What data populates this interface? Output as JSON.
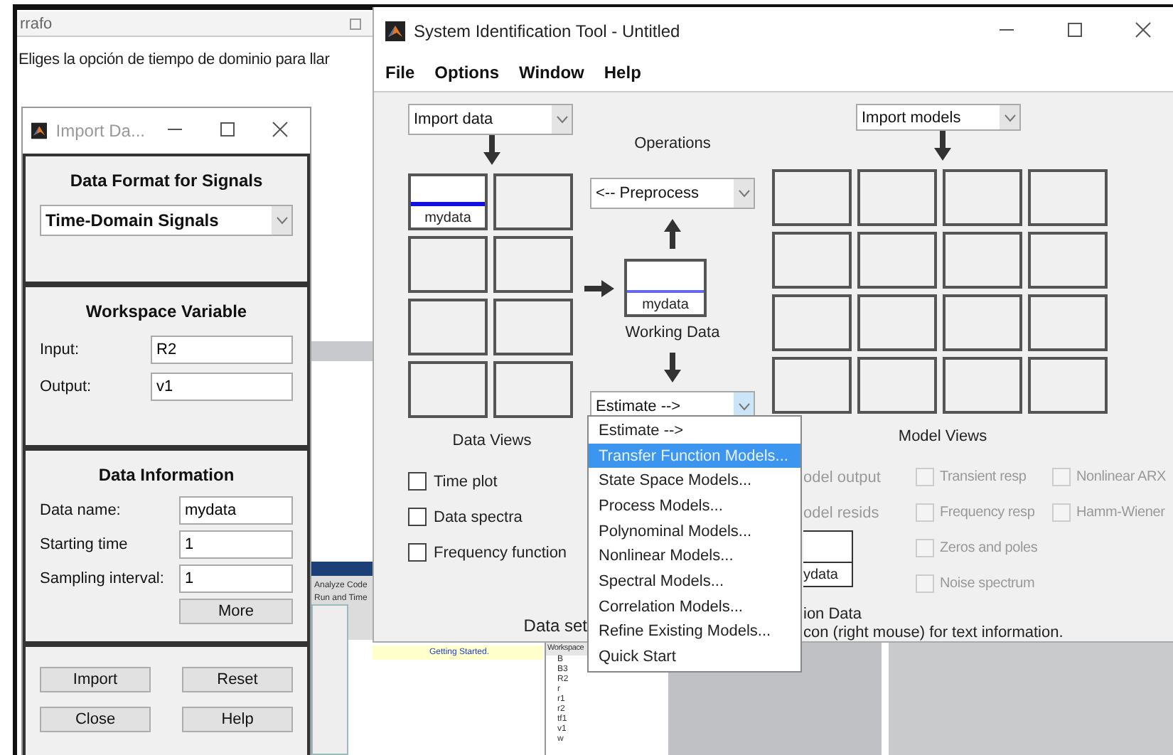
{
  "background_document": {
    "tab_label": "rrafo",
    "text": "Eliges la opción de tiempo de dominio para llar"
  },
  "background_matlab": {
    "toolbar": [
      "Analyze Code",
      "Run and Time"
    ],
    "link": "Getting Started.",
    "workspace_title": "Workspace",
    "variables": [
      "B",
      "B3",
      "R2",
      "r",
      "r1",
      "r2",
      "tf1",
      "v1",
      "w"
    ]
  },
  "import_dialog": {
    "title": "Import Da...",
    "format_title": "Data Format for Signals",
    "format": "Time-Domain Signals",
    "workspace_title": "Workspace Variable",
    "fields": [
      {
        "label": "Input:",
        "value": "R2"
      },
      {
        "label": "Output:",
        "value": "v1"
      }
    ],
    "info_title": "Data Information",
    "info_fields": [
      {
        "label": "Data name:",
        "value": "mydata"
      },
      {
        "label": "Starting time",
        "value": "1"
      },
      {
        "label": "Sampling interval:",
        "value": "1"
      }
    ],
    "more": "More",
    "buttons": [
      "Import",
      "Reset",
      "Close",
      "Help"
    ]
  },
  "main_window": {
    "title": "System Identification Tool - Untitled",
    "menu": [
      "File",
      "Options",
      "Window",
      "Help"
    ],
    "import_data": "Import data",
    "data_board": [
      {
        "label": "mydata"
      }
    ],
    "operations_title": "Operations",
    "preprocess": "<-- Preprocess",
    "working_data": {
      "label": "mydata",
      "title": "Working Data"
    },
    "estimate": "Estimate -->",
    "import_models": "Import models",
    "data_views": {
      "title": "Data Views",
      "options": [
        {
          "label": "Time plot",
          "checked": false,
          "disabled": false
        },
        {
          "label": "Data spectra",
          "checked": false,
          "disabled": false
        },
        {
          "label": "Frequency function",
          "checked": false,
          "disabled": false
        }
      ]
    },
    "data_set_label": "Data set",
    "model_views": {
      "title": "Model Views",
      "partial": [
        "odel output",
        "odel resids"
      ],
      "validation_label": "ydata",
      "validation_title": "ion Data",
      "hint": "con (right mouse) for text information.",
      "option_columns": [
        [
          {
            "label": "Transient resp",
            "checked": false,
            "disabled": true
          },
          {
            "label": "Frequency resp",
            "checked": false,
            "disabled": true
          },
          {
            "label": "Zeros and poles",
            "checked": false,
            "disabled": true
          },
          {
            "label": "Noise spectrum",
            "checked": false,
            "disabled": true
          }
        ],
        [
          {
            "label": "Nonlinear ARX",
            "checked": false,
            "disabled": true
          },
          {
            "label": "Hamm-Wiener",
            "checked": false,
            "disabled": true
          }
        ]
      ]
    }
  },
  "estimate_menu": [
    {
      "label": "Estimate -->",
      "selected": false
    },
    {
      "label": "Transfer Function Models...",
      "selected": true
    },
    {
      "label": "State Space Models...",
      "selected": false
    },
    {
      "label": "Process Models...",
      "selected": false
    },
    {
      "label": "Polynominal Models...",
      "selected": false
    },
    {
      "label": "Nonlinear Models...",
      "selected": false
    },
    {
      "label": "Spectral Models...",
      "selected": false
    },
    {
      "label": "Correlation Models...",
      "selected": false
    },
    {
      "label": "Refine Existing Models...",
      "selected": false
    },
    {
      "label": "Quick Start",
      "selected": false
    }
  ]
}
